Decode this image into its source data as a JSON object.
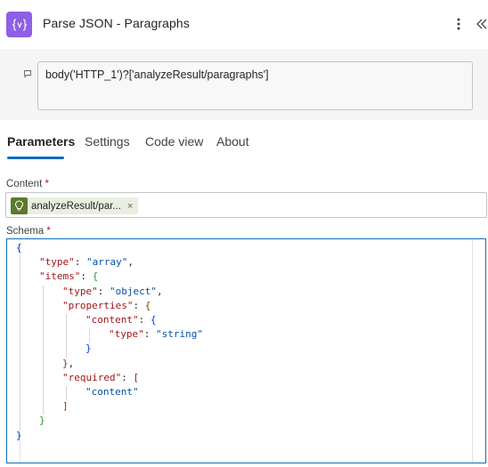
{
  "header": {
    "title": "Parse JSON - Paragraphs",
    "icon": "braces-icon",
    "icon_color": "#8f5fe6"
  },
  "expression": {
    "text": "body('HTTP_1')?['analyzeResult/paragraphs']"
  },
  "tabs": [
    {
      "label": "Parameters",
      "active": true
    },
    {
      "label": "Settings",
      "active": false
    },
    {
      "label": "Code view",
      "active": false
    },
    {
      "label": "About",
      "active": false
    }
  ],
  "content_field": {
    "label": "Content",
    "required_mark": "*",
    "token_label": "analyzeResult/par...",
    "token_close": "×",
    "token_color": "#5a7a2c"
  },
  "schema_field": {
    "label": "Schema",
    "required_mark": "*"
  },
  "schema_lines": [
    {
      "indent": 0,
      "text": "{"
    },
    {
      "indent": 1,
      "text": "\"type\": \"array\","
    },
    {
      "indent": 1,
      "text": "\"items\": {"
    },
    {
      "indent": 2,
      "text": "\"type\": \"object\","
    },
    {
      "indent": 2,
      "text": "\"properties\": {"
    },
    {
      "indent": 3,
      "text": "\"content\": {"
    },
    {
      "indent": 4,
      "text": "\"type\": \"string\""
    },
    {
      "indent": 3,
      "text": "}"
    },
    {
      "indent": 2,
      "text": "},"
    },
    {
      "indent": 2,
      "text": "\"required\": ["
    },
    {
      "indent": 3,
      "text": "\"content\""
    },
    {
      "indent": 2,
      "text": "]"
    },
    {
      "indent": 1,
      "text": "}"
    },
    {
      "indent": 0,
      "text": "}"
    }
  ]
}
